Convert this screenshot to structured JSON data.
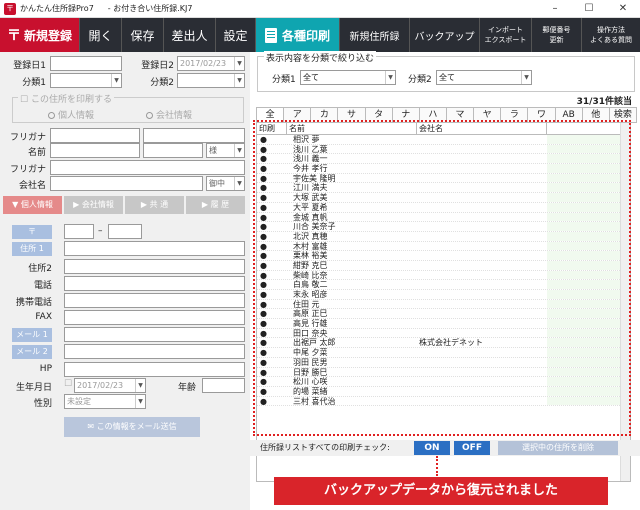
{
  "titlebar": {
    "app": "かんたん住所録Pro7",
    "file": "- お付き合い住所録.KJ7",
    "min": "–",
    "max": "☐",
    "close": "✕"
  },
  "toolbar": {
    "new": "新規登録",
    "open": "開く",
    "save": "保存",
    "sender": "差出人",
    "settings": "設定",
    "print": "各種印刷",
    "new_book": "新規住所録",
    "backup": "バックアップ",
    "import1": "インポート",
    "import2": "エクスポート",
    "postal1": "郵便番号",
    "postal2": "更新",
    "manual1": "操作方法",
    "manual2": "よくある質問"
  },
  "form": {
    "reg1": "登録日1",
    "reg2": "登録日2",
    "reg2_value": "2017/02/23",
    "class1": "分類1",
    "class2": "分類2",
    "print_group": "この住所を印刷する",
    "personal": "個人情報",
    "company": "会社情報",
    "furigana": "フリガナ",
    "name": "名前",
    "honorific": "様",
    "furigana2": "フリガナ",
    "company_name": "会社名",
    "company_honorific": "御中",
    "tabs": [
      "▼ 個人情報",
      "▶ 会社情報",
      "▶ 共 通",
      "▶ 履 歴"
    ],
    "postal_btn": "〒",
    "dash": "–",
    "addr1_btn": "住所 1",
    "addr2": "住所2",
    "tel": "電話",
    "mobile": "携帯電話",
    "fax": "FAX",
    "mail1_btn": "メール 1",
    "mail2_btn": "メール 2",
    "hp": "HP",
    "birthday": "生年月日",
    "birthday_value": "2017/02/23",
    "age": "年齢",
    "gender": "性別",
    "gender_value": "未設定",
    "mail_send": "この情報をメール送信"
  },
  "filter": {
    "caption": "表示内容を分類で絞り込む",
    "c1": "分類1",
    "c1_value": "全て",
    "c2": "分類2",
    "c2_value": "全て"
  },
  "count": "31/31件該当",
  "kana": [
    "全",
    "ア",
    "カ",
    "サ",
    "タ",
    "ナ",
    "ハ",
    "マ",
    "ヤ",
    "ラ",
    "ワ",
    "AB",
    "他",
    "検索"
  ],
  "list": {
    "headers": [
      "印刷",
      "名前",
      "会社名"
    ],
    "rows": [
      {
        "name": "相沢 夢",
        "company": ""
      },
      {
        "name": "浅川 乙葉",
        "company": ""
      },
      {
        "name": "浅川 義一",
        "company": ""
      },
      {
        "name": "今井 孝行",
        "company": ""
      },
      {
        "name": "宇佐美 隆明",
        "company": ""
      },
      {
        "name": "江川 満夫",
        "company": ""
      },
      {
        "name": "大塚 武美",
        "company": ""
      },
      {
        "name": "大平 夏希",
        "company": ""
      },
      {
        "name": "金城 真帆",
        "company": ""
      },
      {
        "name": "川合 美奈子",
        "company": ""
      },
      {
        "name": "北沢 真穂",
        "company": ""
      },
      {
        "name": "木村 富雄",
        "company": ""
      },
      {
        "name": "栗林 裕美",
        "company": ""
      },
      {
        "name": "紺野 克巳",
        "company": ""
      },
      {
        "name": "柴崎 比奈",
        "company": ""
      },
      {
        "name": "白鳥 敬二",
        "company": ""
      },
      {
        "name": "末永 昭彦",
        "company": ""
      },
      {
        "name": "住田 元",
        "company": ""
      },
      {
        "name": "高原 正巳",
        "company": ""
      },
      {
        "name": "高見 行雄",
        "company": ""
      },
      {
        "name": "田口 奈央",
        "company": ""
      },
      {
        "name": "出裾戸 太郎",
        "company": "株式会社デネット"
      },
      {
        "name": "中尾 夕菜",
        "company": ""
      },
      {
        "name": "羽田 民男",
        "company": ""
      },
      {
        "name": "日野 勝巳",
        "company": ""
      },
      {
        "name": "松川 心咲",
        "company": ""
      },
      {
        "name": "的場 菜緒",
        "company": ""
      },
      {
        "name": "三村 喜代治",
        "company": ""
      }
    ]
  },
  "bottom": {
    "label": "住所録リストすべての印刷チェック:",
    "on": "ON",
    "off": "OFF",
    "delete": "選択中の住所を削除"
  },
  "toast": "バックアップデータから復元されました",
  "colors": {
    "accent": "#c8102e",
    "teal": "#0fa5b0",
    "toolbar": "#2a2d34",
    "toggle": "#2b6fc3"
  }
}
